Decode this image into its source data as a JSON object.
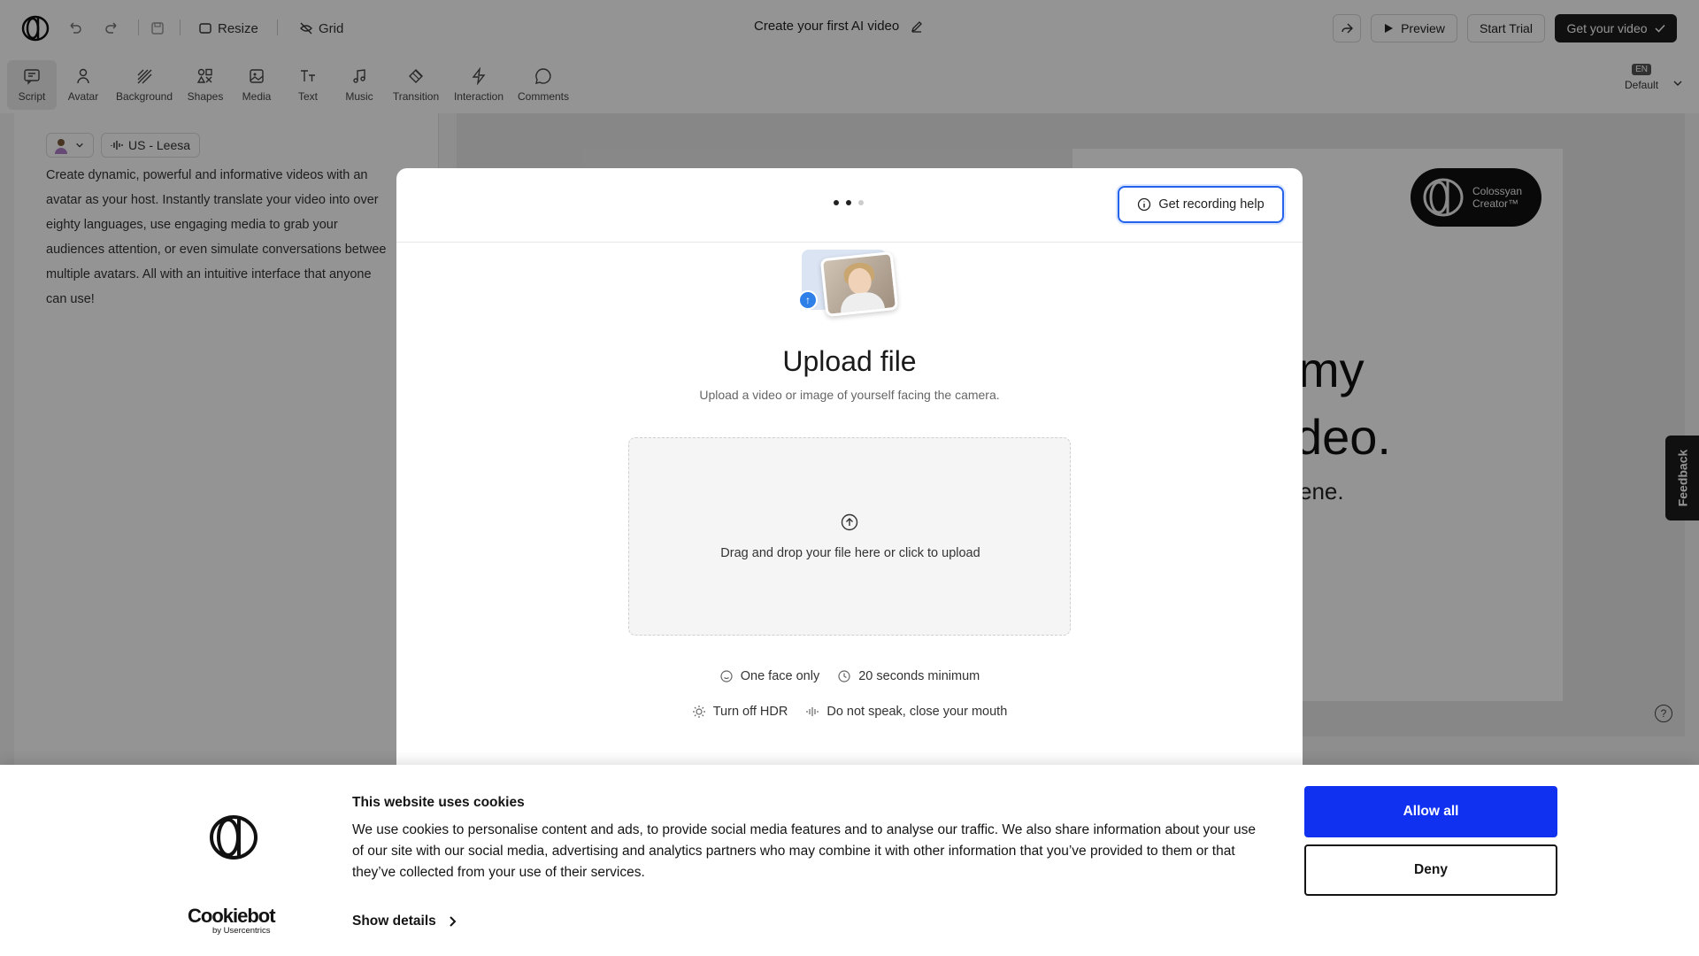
{
  "header": {
    "resize_label": "Resize",
    "grid_label": "Grid",
    "title": "Create your first AI video",
    "preview_label": "Preview",
    "start_trial_label": "Start Trial",
    "get_video_label": "Get your video"
  },
  "toolbar": {
    "tools": [
      {
        "label": "Script",
        "icon": "script-icon",
        "active": true
      },
      {
        "label": "Avatar",
        "icon": "avatar-icon"
      },
      {
        "label": "Background",
        "icon": "background-icon"
      },
      {
        "label": "Shapes",
        "icon": "shapes-icon"
      },
      {
        "label": "Media",
        "icon": "media-icon"
      },
      {
        "label": "Text",
        "icon": "text-icon"
      },
      {
        "label": "Music",
        "icon": "music-icon"
      },
      {
        "label": "Transition",
        "icon": "transition-icon"
      },
      {
        "label": "Interaction",
        "icon": "interaction-icon"
      },
      {
        "label": "Comments",
        "icon": "comments-icon"
      }
    ],
    "lang_badge": "EN",
    "lang_label": "Default"
  },
  "script": {
    "voice_label": "US - Leesa",
    "lines": [
      "Create dynamic, powerful and informative videos with an",
      "avatar as your host. Instantly translate your video into over",
      "eighty languages, use engaging media to grab your",
      "audiences attention, or even simulate conversations betwee",
      "multiple avatars. All with an intuitive interface that anyone",
      "can use!"
    ]
  },
  "slide": {
    "logo_line1": "Colossyan",
    "logo_line2": "Creator™",
    "heading_line1": "e to my",
    "heading_line2": "ul AI video.",
    "subheading": "scene."
  },
  "feedback_label": "Feedback",
  "help_label": "?",
  "modal": {
    "help_button_label": "Get recording help",
    "title": "Upload file",
    "subtitle": "Upload a video or image of yourself facing the camera.",
    "dropzone_text": "Drag and drop your file here or click to upload",
    "requirements": {
      "one_face": "One face only",
      "seconds": "20 seconds minimum",
      "hdr": "Turn off HDR",
      "speak": "Do not speak, close your mouth"
    },
    "step_current": 2,
    "step_total": 3
  },
  "cookie_banner": {
    "title": "This website uses cookies",
    "body": "We use cookies to personalise content and ads, to provide social media features and to analyse our traffic. We also share information about your use of our site with our social media, advertising and analytics partners who may combine it with other information that you’ve provided to them or that they’ve collected from your use of their services.",
    "show_details_label": "Show details",
    "allow_label": "Allow all",
    "deny_label": "Deny",
    "brand": "Cookiebot",
    "brand_sub": "by Usercentrics",
    "allow_color": "#1032f0"
  }
}
